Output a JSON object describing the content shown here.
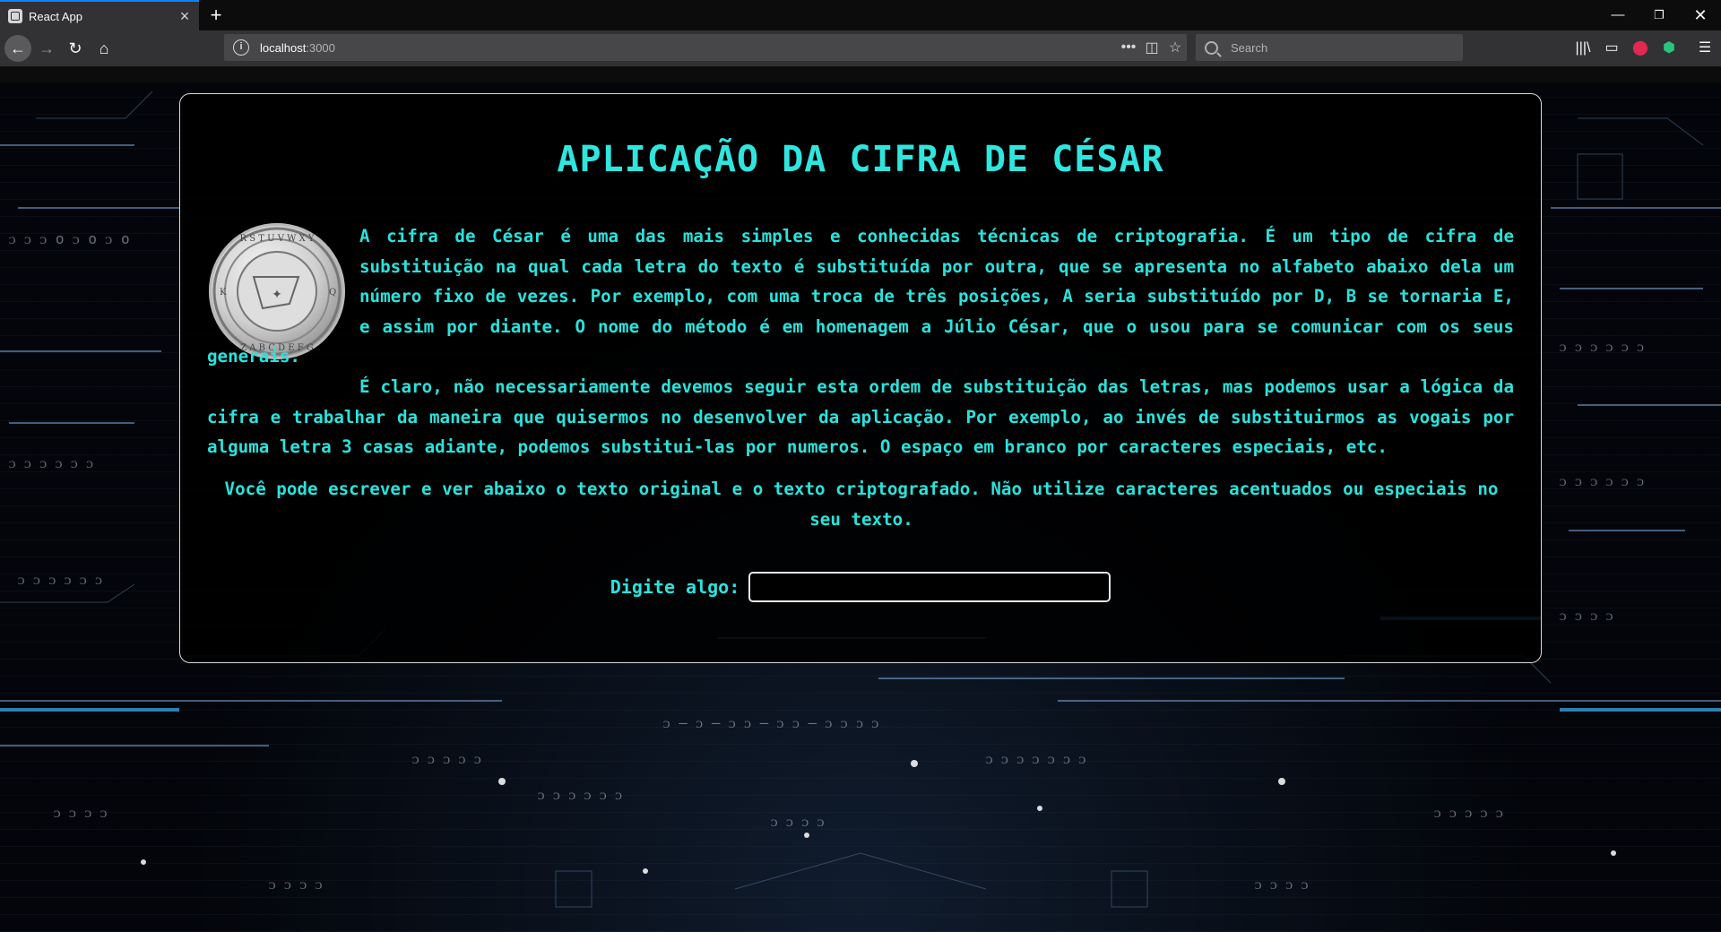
{
  "browser": {
    "tab_title": "React App",
    "url_host": "localhost",
    "url_port": ":3000",
    "search_placeholder": "Search",
    "accent": "#0a84ff"
  },
  "page": {
    "title": "APLICAÇÃO DA CIFRA DE CÉSAR",
    "paragraph1": "A cifra de César é uma das mais simples e conhecidas técnicas de criptografia. É um tipo de cifra de substituição na qual cada letra do texto é substituída por outra, que se apresenta no alfabeto abaixo dela um número fixo de vezes. Por exemplo, com uma troca de três posições, A seria substituído por D, B se tornaria E, e assim por diante. O nome do método é em homenagem a Júlio César, que o usou para se comunicar com os seus generais.",
    "paragraph2": "É claro, não necessariamente devemos seguir esta ordem de substituição das letras, mas podemos usar a lógica da cifra e trabalhar da maneira que quisermos no desenvolver da aplicação. Por exemplo, ao invés de substituirmos as vogais por alguma letra 3 casas adiante, podemos substitui-las por numeros. O espaço em branco por caracteres especiais, etc.",
    "instructions": "Você pode escrever e ver abaixo o texto original e o texto criptografado. Não utilize caracteres acentuados ou especiais no seu texto.",
    "input_label": "Digite algo:",
    "input_value": "",
    "text_color": "#29e3dc"
  },
  "icons": {
    "coin_image": "caesar-cipher-wheel-icon"
  }
}
